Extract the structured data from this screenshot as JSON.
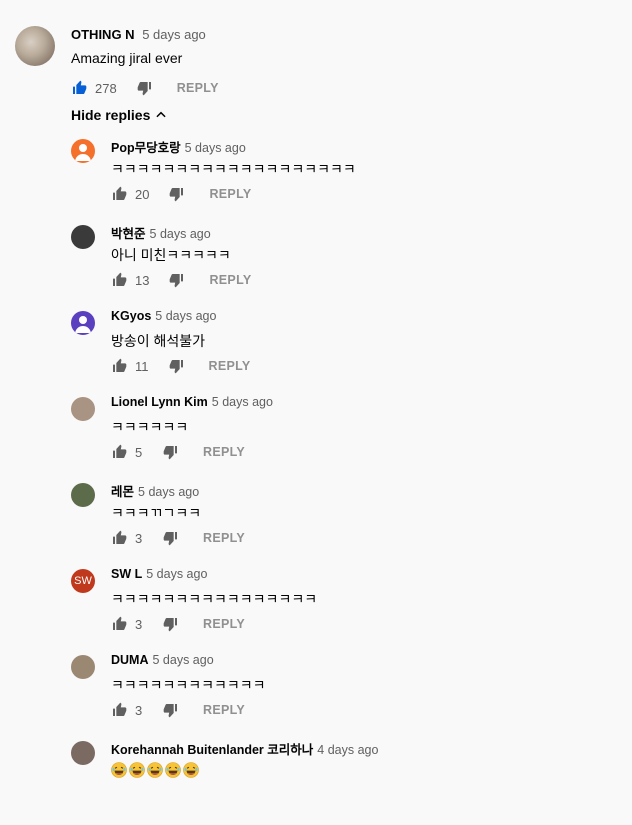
{
  "main_comment": {
    "author": "OTHING N",
    "time": "5 days ago",
    "text": "Amazing jiral ever",
    "likes": "278",
    "reply_label": "REPLY"
  },
  "hide_replies_label": "Hide replies",
  "replies": [
    {
      "author": "Pop무당호랑",
      "time": "5 days ago",
      "text": "ㅋㅋㅋㅋㅋㅋㅋㅋㅋㅋㅋㅋㅋㅋㅋㅋㅋㅋㅋ",
      "likes": "20",
      "reply_label": "REPLY",
      "avatar_color": "#f4702b",
      "avatar_icon": "person-icon"
    },
    {
      "author": "박현준",
      "time": "5 days ago",
      "text": "아니 미친ㅋㅋㅋㅋㅋ",
      "likes": "13",
      "reply_label": "REPLY",
      "avatar_color": "#3a3a3a"
    },
    {
      "author": "KGyos",
      "time": "5 days ago",
      "text": "방송이 해석불가",
      "likes": "11",
      "reply_label": "REPLY",
      "avatar_color": "#5a3fbf",
      "avatar_icon": "person-icon"
    },
    {
      "author": "Lionel Lynn Kim",
      "time": "5 days ago",
      "text": "ㅋㅋㅋㅋㅋㅋ",
      "likes": "5",
      "reply_label": "REPLY",
      "avatar_color": "#a99382"
    },
    {
      "author": "레몬",
      "time": "5 days ago",
      "text": "ㅋㅋㅋㄲㄱㅋㅋ",
      "likes": "3",
      "reply_label": "REPLY",
      "avatar_color": "#5c6b4a"
    },
    {
      "author": "SW L",
      "time": "5 days ago",
      "text": "ㅋㅋㅋㅋㅋㅋㅋㅋㅋㅋㅋㅋㅋㅋㅋㅋ",
      "likes": "3",
      "reply_label": "REPLY",
      "avatar_color": "#c0391c",
      "avatar_initials": "SW"
    },
    {
      "author": "DUMA",
      "time": "5 days ago",
      "text": "ㅋㅋㅋㅋㅋㅋㅋㅋㅋㅋㅋㅋ",
      "likes": "3",
      "reply_label": "REPLY",
      "avatar_color": "#9a8873"
    },
    {
      "author": "Korehannah Buitenlander 코리하나",
      "time": "4 days ago",
      "text": "",
      "emoji_count": 5,
      "emoji_name": "laughing-face",
      "avatar_color": "#7b6a62"
    }
  ]
}
